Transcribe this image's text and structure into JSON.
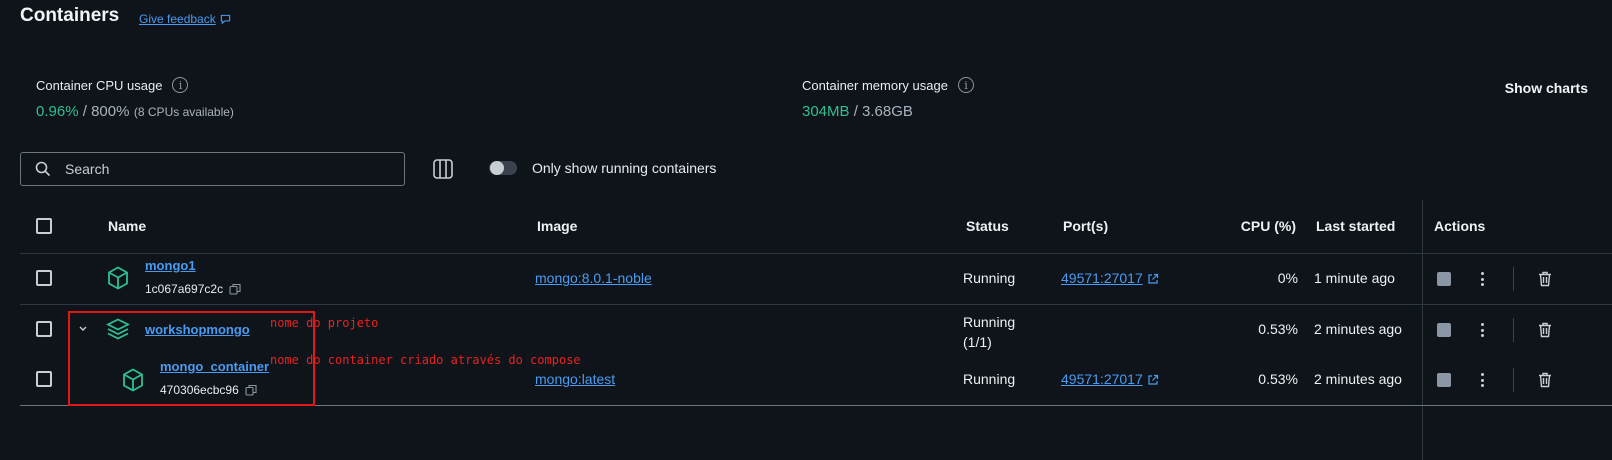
{
  "header": {
    "title": "Containers",
    "feedback_label": "Give feedback"
  },
  "metrics": {
    "cpu_label": "Container CPU usage",
    "cpu_used": "0.96%",
    "cpu_sep": " / ",
    "cpu_total": "800%",
    "cpu_note": "(8 CPUs available)",
    "mem_label": "Container memory usage",
    "mem_used": "304MB",
    "mem_sep": " / ",
    "mem_total": "3.68GB",
    "show_charts_label": "Show charts"
  },
  "toolbar": {
    "search_placeholder": "Search",
    "running_only_label": "Only show running containers",
    "running_only_on": false
  },
  "table": {
    "columns": {
      "name": "Name",
      "image": "Image",
      "status": "Status",
      "ports": "Port(s)",
      "cpu": "CPU (%)",
      "last_started": "Last started",
      "actions": "Actions"
    },
    "rows": [
      {
        "name": "mongo1",
        "id": "1c067a697c2c",
        "image": "mongo:8.0.1-noble",
        "status": "Running",
        "ports": "49571:27017",
        "cpu": "0%",
        "last_started": "1 minute ago"
      },
      {
        "name": "workshopmongo",
        "status_line1": "Running",
        "status_line2": "(1/1)",
        "cpu": "0.53%",
        "last_started": "2 minutes ago"
      },
      {
        "name": "mongo_container",
        "id": "470306ecbc96",
        "image": "mongo:latest",
        "status": "Running",
        "ports": "49571:27017",
        "cpu": "0.53%",
        "last_started": "2 minutes ago"
      }
    ]
  },
  "annotations": {
    "project_note": "nome do projeto",
    "container_note": "nome do container criado através do compose"
  },
  "colors": {
    "background": "#0f141a",
    "accent_link": "#4a9bf2",
    "metric_green": "#2fbf8f",
    "annotation_red": "#e01818",
    "container_icon": "#2fbf8f"
  },
  "icons": {
    "feedback": "chat-icon",
    "search": "search-icon",
    "columns": "columns-icon",
    "container": "cube-icon",
    "compose": "stack-icon",
    "external": "external-link-icon",
    "copy": "copy-icon",
    "stop": "stop-icon",
    "more": "kebab-icon",
    "delete": "trash-icon",
    "expand": "chevron-down-icon",
    "info": "info-icon"
  }
}
